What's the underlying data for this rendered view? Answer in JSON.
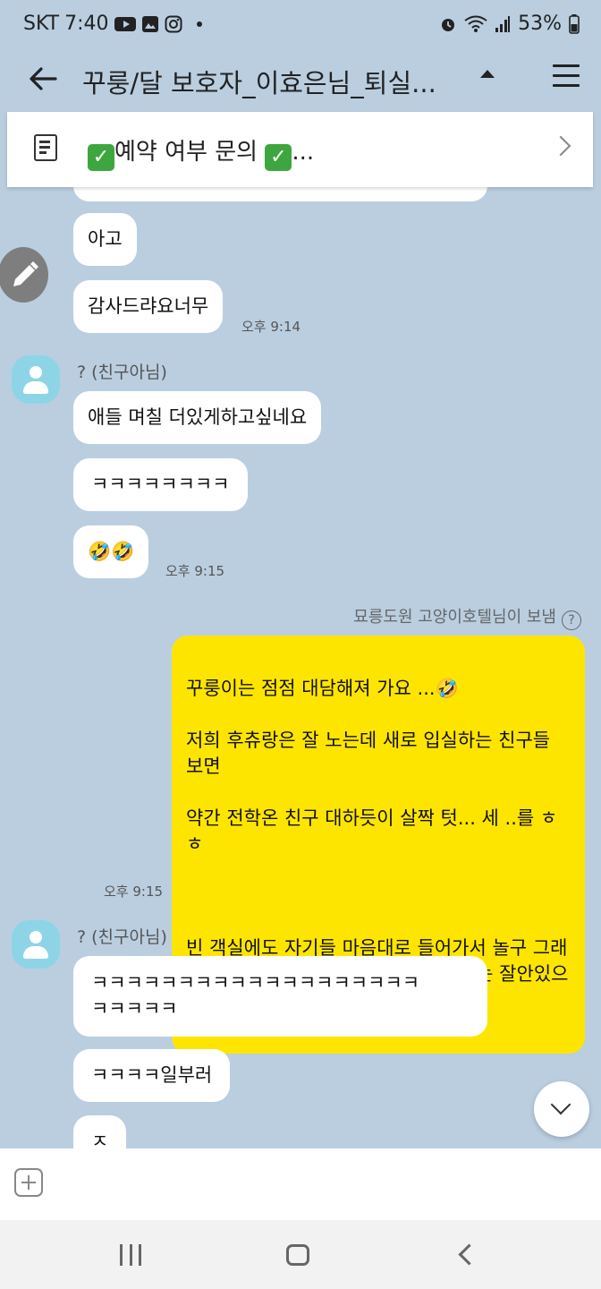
{
  "status_bar": {
    "carrier": "SKT",
    "time": "7:40",
    "battery": "53%"
  },
  "header": {
    "title": "꾸룽/달 보호자_이효은님_퇴실..."
  },
  "notice": {
    "text": "예약 여부 문의",
    "suffix": "..."
  },
  "messages": {
    "m1": "아고",
    "m2": "감사드랴요너무",
    "t1": "오후 9:14",
    "sender1": "? (친구아님)",
    "m3": "애들 며칠 더있게하고싶네요",
    "m4": "ㅋㅋㅋㅋㅋㅋㅋㅋ",
    "m5": "🤣🤣",
    "t2": "오후 9:15",
    "sent_by": "묘릉도원 고양이호텔님이 보냄",
    "mine_lines": [
      "꾸룽이는 점점 대담해져 가요 ...🤣",
      "저희 후츄랑은 잘 노는데 새로 입실하는 친구들 보면",
      "약간 전학온 친구 대하듯이  살짝 텃... 세 ..를 ㅎㅎ",
      "",
      "빈 객실에도 자기들 마음대로 들어가서 놀구 그래요 🤣🤣 제일 좋은방 쓰면서 꼭 방에는 잘안있으려구하더라구요 ㅋㅋㅋ"
    ],
    "t3": "오후 9:15",
    "sender2": "? (친구아님)",
    "m6": "ㅋㅋㅋㅋㅋㅋㅋㅋㅋㅋㅋㅋㅋㅋㅋㅋㅋㅋㅋ\nㅋㅋㅋㅋㅋ",
    "m7": "ㅋㅋㅋㅋ일부러",
    "m8": "ㅈ"
  },
  "colors": {
    "chat_bg": "#BACEE0",
    "my_bubble": "#FEE500",
    "avatar": "#8DD5E6"
  }
}
